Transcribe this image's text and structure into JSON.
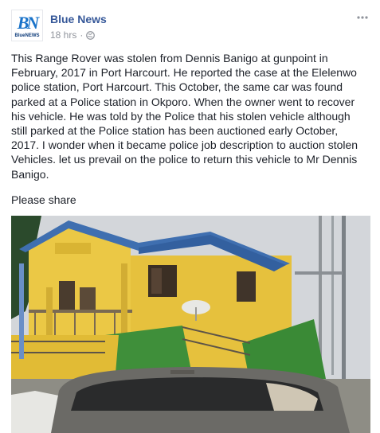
{
  "header": {
    "page_name": "Blue News",
    "timestamp": "18 hrs",
    "separator": "·",
    "avatar_letters": "BN",
    "avatar_caption": "BlueNEWS"
  },
  "post": {
    "text": "This Range Rover was stolen from Dennis Banigo at gunpoint in February, 2017 in Port Harcourt. He reported the case at the Elelenwo police station, Port Harcourt. This October, the same car was found parked at a Police station in Okporo. When the owner went to recover his vehicle. He was told by the Police that his stolen vehicle although still parked at the Police station has been auctioned early October, 2017. I wonder when it became police job description to auction stolen Vehicles. let us prevail on the police to return this vehicle to Mr Dennis Banigo.",
    "footer_line": "Please share"
  },
  "icons": {
    "privacy": "globe-icon",
    "options": "more-options-icon"
  },
  "colors": {
    "page_name": "#365899",
    "meta_text": "#90949c",
    "body_text": "#1d2129",
    "building_wall": "#e8c23a",
    "roof": "#3f6fb0",
    "ramp_green": "#3f8f3a"
  }
}
